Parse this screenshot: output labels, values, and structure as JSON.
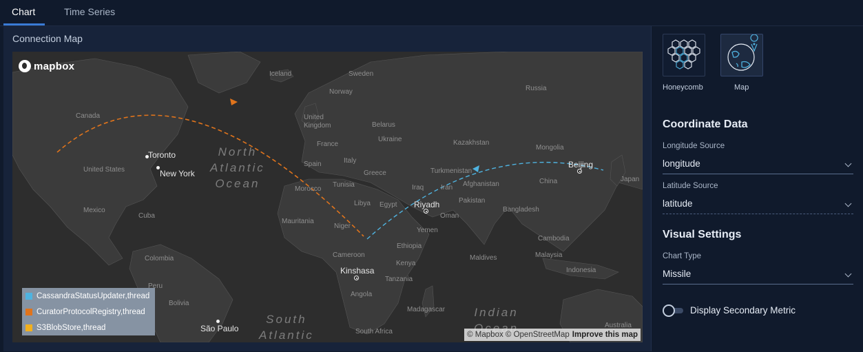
{
  "tabs": [
    {
      "label": "Chart",
      "active": true
    },
    {
      "label": "Time Series",
      "active": false
    }
  ],
  "panel": {
    "title": "Connection Map"
  },
  "map": {
    "logo_text": "mapbox",
    "attribution": "© Mapbox © OpenStreetMap",
    "improve_link": "Improve this map",
    "oceans": [
      {
        "id": "north-atlantic",
        "text": "North\nAtlantic\nOcean"
      },
      {
        "id": "south-atlantic",
        "text": "South\nAtlantic"
      },
      {
        "id": "indian",
        "text": "Indian\nOcean"
      }
    ],
    "countries": [
      "Iceland",
      "Sweden",
      "Norway",
      "Russia",
      "Canada",
      "United Kingdom",
      "Belarus",
      "France",
      "Ukraine",
      "Kazakhstan",
      "Mongolia",
      "Spain",
      "Italy",
      "Turkmenistan",
      "Greece",
      "United States",
      "China",
      "Japan",
      "Morocco",
      "Tunisia",
      "Iraq",
      "Iran",
      "Libya",
      "Egypt",
      "Afghanistan",
      "Pakistan",
      "Mexico",
      "Cuba",
      "Mauritania",
      "Niger",
      "Oman",
      "Bangladesh",
      "Yemen",
      "Ethiopia",
      "Cambodia",
      "Colombia",
      "Cameroon",
      "Kenya",
      "Maldives",
      "Malaysia",
      "Peru",
      "Tanzania",
      "Indonesia",
      "Bolivia",
      "Angola",
      "Madagascar",
      "Australia",
      "South Africa"
    ],
    "cities": [
      "Toronto",
      "New York",
      "Beijing",
      "Riyadh",
      "Kinshasa",
      "São Paulo"
    ],
    "legend": [
      {
        "label": "CassandraStatusUpdater,thread",
        "color": "#4fb3e0"
      },
      {
        "label": "CuratorProtocolRegistry,thread",
        "color": "#e0741c"
      },
      {
        "label": "S3BlobStore,thread",
        "color": "#f2b01e"
      }
    ],
    "colors": {
      "land": "#3b3b3b",
      "water": "#2d2d2d",
      "arc_orange": "#e0741c",
      "arc_blue": "#4fb3e0"
    }
  },
  "side": {
    "chart_types": [
      {
        "label": "Honeycomb",
        "icon": "honeycomb-icon",
        "selected": false
      },
      {
        "label": "Map",
        "icon": "globe-pin-icon",
        "selected": true
      }
    ],
    "coordinate_title": "Coordinate Data",
    "longitude_label": "Longitude Source",
    "longitude_value": "longitude",
    "latitude_label": "Latitude Source",
    "latitude_value": "latitude",
    "visual_title": "Visual Settings",
    "chart_type_label": "Chart Type",
    "chart_type_value": "Missile",
    "secondary_label": "Display Secondary Metric",
    "secondary_enabled": false
  }
}
